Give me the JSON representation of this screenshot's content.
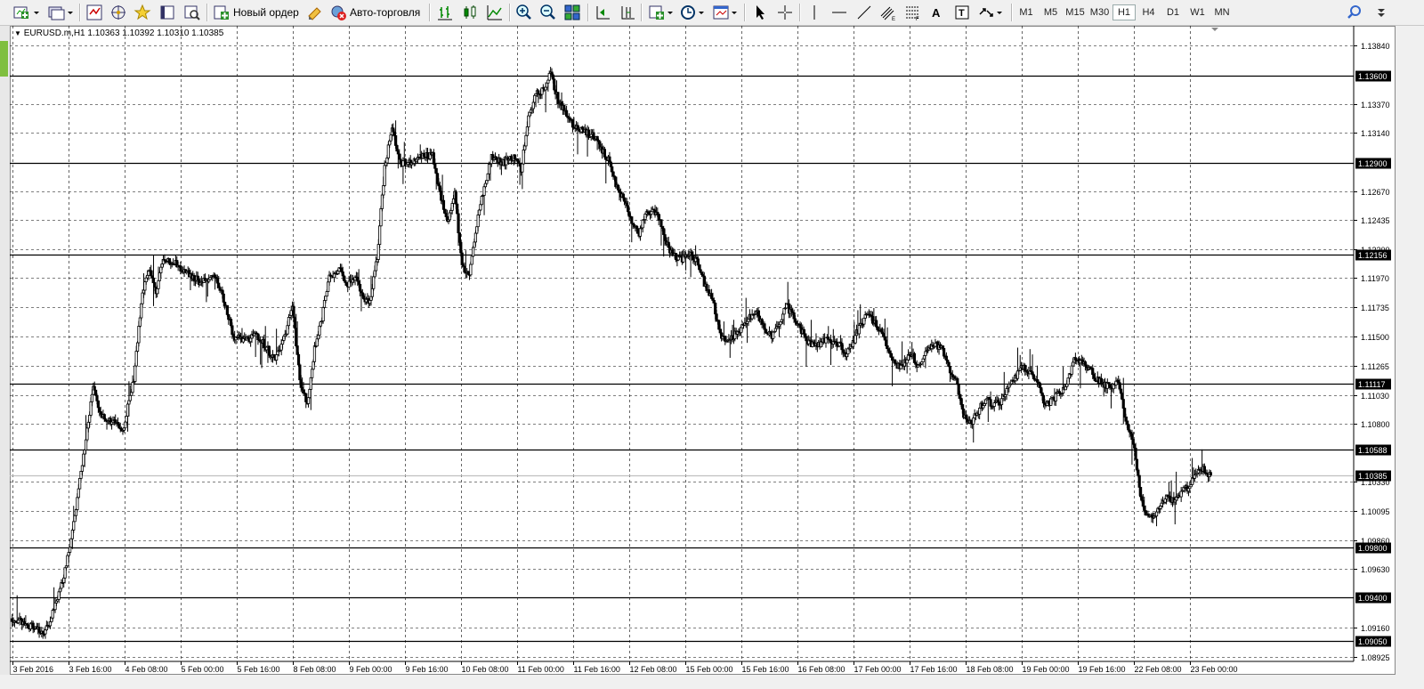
{
  "toolbar": {
    "new_order_label": "Новый ордер",
    "auto_trading_label": "Авто-торговля",
    "timeframes": [
      {
        "label": "M1",
        "active": false
      },
      {
        "label": "M5",
        "active": false
      },
      {
        "label": "M15",
        "active": false
      },
      {
        "label": "M30",
        "active": false
      },
      {
        "label": "H1",
        "active": true
      },
      {
        "label": "H4",
        "active": false
      },
      {
        "label": "D1",
        "active": false
      },
      {
        "label": "W1",
        "active": false
      },
      {
        "label": "MN",
        "active": false
      }
    ],
    "icons": [
      "new-chart-icon",
      "profiles-icon",
      "market-watch-icon",
      "navigator-icon",
      "favorites-icon",
      "data-window-icon",
      "strategy-tester-icon",
      "new-order-icon",
      "meta-editor-icon",
      "auto-trading-icon",
      "bar-chart-icon",
      "candlestick-icon",
      "line-chart-icon",
      "zoom-in-icon",
      "zoom-out-icon",
      "tile-windows-icon",
      "autoscroll-icon",
      "chart-shift-icon",
      "indicators-icon",
      "periods-icon",
      "templates-icon",
      "cursor-icon",
      "crosshair-icon",
      "vertical-line-icon",
      "horizontal-line-icon",
      "trendline-icon",
      "equidistant-channel-icon",
      "fibonacci-icon",
      "text-icon",
      "text-label-icon",
      "arrows-icon",
      "search-icon"
    ]
  },
  "colors": {
    "background": "#ffffff",
    "grid": "#000000",
    "candle": "#000000",
    "hline": "#000000",
    "bid_line": "#c0c0c0",
    "label_bg": "#000000",
    "label_fg": "#ffffff"
  },
  "chart_data": {
    "type": "candlestick",
    "title": "EURUSD.m,H1  1.10363 1.10392 1.10310 1.10385",
    "symbol": "EURUSD.m",
    "timeframe": "H1",
    "ohlc": {
      "open": 1.10363,
      "high": 1.10392,
      "low": 1.1031,
      "close": 1.10385
    },
    "price_ticks": [
      1.1384,
      1.1337,
      1.1314,
      1.1267,
      1.12435,
      1.122,
      1.1197,
      1.11735,
      1.115,
      1.11265,
      1.1103,
      1.108,
      1.1033,
      1.10095,
      1.0986,
      1.0963,
      1.0916,
      1.08925
    ],
    "time_ticks": [
      "3 Feb 2016",
      "3 Feb 16:00",
      "4 Feb 08:00",
      "5 Feb 00:00",
      "5 Feb 16:00",
      "8 Feb 08:00",
      "9 Feb 00:00",
      "9 Feb 16:00",
      "10 Feb 08:00",
      "11 Feb 00:00",
      "11 Feb 16:00",
      "12 Feb 08:00",
      "15 Feb 00:00",
      "15 Feb 16:00",
      "16 Feb 08:00",
      "17 Feb 00:00",
      "17 Feb 16:00",
      "18 Feb 08:00",
      "19 Feb 00:00",
      "19 Feb 16:00",
      "22 Feb 08:00",
      "23 Feb 00:00"
    ],
    "horizontal_lines": [
      1.136,
      1.129,
      1.12156,
      1.11117,
      1.10588,
      1.098,
      1.094,
      1.0905
    ],
    "bid_line": 1.10385,
    "ylim": [
      1.089,
      1.14
    ],
    "grid": true,
    "path": [
      [
        0,
        1.0923
      ],
      [
        9,
        1.0912
      ],
      [
        13,
        1.0945
      ],
      [
        16,
        1.0985
      ],
      [
        18,
        1.1028
      ],
      [
        20,
        1.1068
      ],
      [
        22,
        1.111
      ],
      [
        24,
        1.1085
      ],
      [
        27,
        1.1082
      ],
      [
        30,
        1.1075
      ],
      [
        33,
        1.1115
      ],
      [
        35,
        1.1178
      ],
      [
        37,
        1.1205
      ],
      [
        39,
        1.1185
      ],
      [
        41,
        1.1212
      ],
      [
        44,
        1.121
      ],
      [
        47,
        1.1202
      ],
      [
        51,
        1.1194
      ],
      [
        55,
        1.12
      ],
      [
        57,
        1.1183
      ],
      [
        60,
        1.115
      ],
      [
        63,
        1.1148
      ],
      [
        66,
        1.115
      ],
      [
        68,
        1.1145
      ],
      [
        71,
        1.1132
      ],
      [
        74,
        1.115
      ],
      [
        76,
        1.1175
      ],
      [
        78,
        1.1115
      ],
      [
        80,
        1.1095
      ],
      [
        82,
        1.114
      ],
      [
        84,
        1.1165
      ],
      [
        86,
        1.1198
      ],
      [
        89,
        1.1205
      ],
      [
        91,
        1.119
      ],
      [
        93,
        1.12
      ],
      [
        95,
        1.1182
      ],
      [
        97,
        1.1178
      ],
      [
        99,
        1.1215
      ],
      [
        101,
        1.1285
      ],
      [
        103,
        1.132
      ],
      [
        105,
        1.129
      ],
      [
        108,
        1.129
      ],
      [
        111,
        1.1295
      ],
      [
        114,
        1.1295
      ],
      [
        116,
        1.1265
      ],
      [
        118,
        1.124
      ],
      [
        120,
        1.1268
      ],
      [
        121,
        1.1235
      ],
      [
        122,
        1.1205
      ],
      [
        124,
        1.12
      ],
      [
        126,
        1.124
      ],
      [
        128,
        1.127
      ],
      [
        130,
        1.1295
      ],
      [
        133,
        1.129
      ],
      [
        136,
        1.1295
      ],
      [
        138,
        1.1285
      ],
      [
        140,
        1.1325
      ],
      [
        142,
        1.1345
      ],
      [
        144,
        1.1348
      ],
      [
        146,
        1.1362
      ],
      [
        148,
        1.134
      ],
      [
        150,
        1.133
      ],
      [
        152,
        1.132
      ],
      [
        155,
        1.1315
      ],
      [
        158,
        1.131
      ],
      [
        160,
        1.13
      ],
      [
        162,
        1.129
      ],
      [
        164,
        1.127
      ],
      [
        166,
        1.126
      ],
      [
        168,
        1.124
      ],
      [
        170,
        1.1232
      ],
      [
        172,
        1.125
      ],
      [
        174,
        1.1252
      ],
      [
        176,
        1.124
      ],
      [
        178,
        1.122
      ],
      [
        181,
        1.1212
      ],
      [
        184,
        1.1215
      ],
      [
        186,
        1.121
      ],
      [
        188,
        1.119
      ],
      [
        190,
        1.118
      ],
      [
        192,
        1.115
      ],
      [
        194,
        1.1145
      ],
      [
        196,
        1.1152
      ],
      [
        198,
        1.1158
      ],
      [
        200,
        1.1165
      ],
      [
        202,
        1.117
      ],
      [
        204,
        1.1155
      ],
      [
        206,
        1.115
      ],
      [
        208,
        1.116
      ],
      [
        210,
        1.1175
      ],
      [
        212,
        1.1165
      ],
      [
        214,
        1.1155
      ],
      [
        216,
        1.1145
      ],
      [
        218,
        1.1142
      ],
      [
        221,
        1.1148
      ],
      [
        224,
        1.1145
      ],
      [
        226,
        1.1135
      ],
      [
        228,
        1.1145
      ],
      [
        230,
        1.116
      ],
      [
        232,
        1.1168
      ],
      [
        234,
        1.116
      ],
      [
        236,
        1.115
      ],
      [
        238,
        1.1135
      ],
      [
        240,
        1.1125
      ],
      [
        242,
        1.113
      ],
      [
        244,
        1.1135
      ],
      [
        246,
        1.1125
      ],
      [
        248,
        1.114
      ],
      [
        250,
        1.1145
      ],
      [
        252,
        1.114
      ],
      [
        254,
        1.1125
      ],
      [
        256,
        1.1115
      ],
      [
        258,
        1.1085
      ],
      [
        260,
        1.108
      ],
      [
        262,
        1.109
      ],
      [
        264,
        1.11
      ],
      [
        266,
        1.1095
      ],
      [
        268,
        1.1098
      ],
      [
        270,
        1.111
      ],
      [
        272,
        1.1118
      ],
      [
        274,
        1.1125
      ],
      [
        276,
        1.112
      ],
      [
        278,
        1.1115
      ],
      [
        280,
        1.1095
      ],
      [
        282,
        1.1098
      ],
      [
        284,
        1.1105
      ],
      [
        286,
        1.111
      ],
      [
        288,
        1.1132
      ],
      [
        290,
        1.113
      ],
      [
        292,
        1.1125
      ],
      [
        294,
        1.1115
      ],
      [
        296,
        1.1112
      ],
      [
        298,
        1.1108
      ],
      [
        300,
        1.1115
      ],
      [
        302,
        1.108
      ],
      [
        304,
        1.1065
      ],
      [
        306,
        1.1022
      ],
      [
        307,
        1.101
      ],
      [
        309,
        1.1005
      ],
      [
        311,
        1.1012
      ],
      [
        313,
        1.102
      ],
      [
        315,
        1.1018
      ],
      [
        317,
        1.1025
      ],
      [
        319,
        1.1028
      ],
      [
        321,
        1.104
      ],
      [
        323,
        1.1043
      ],
      [
        325,
        1.1038
      ]
    ]
  }
}
